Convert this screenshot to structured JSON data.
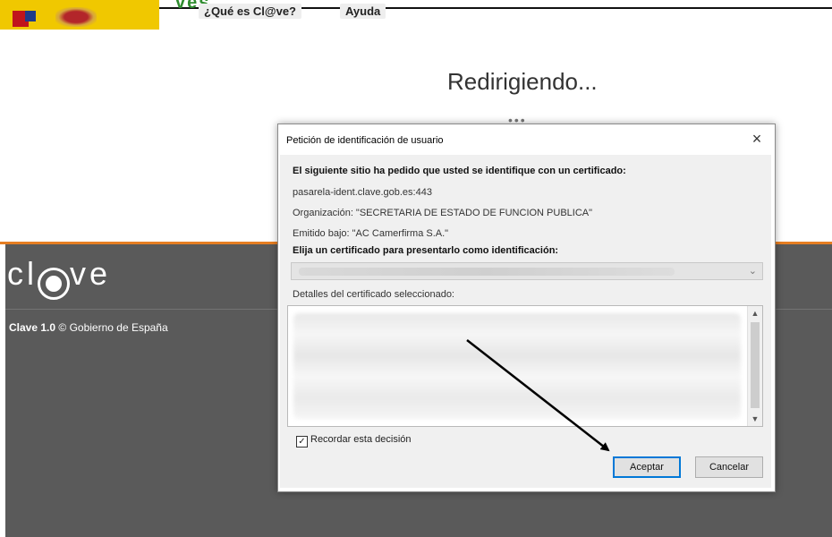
{
  "header": {
    "green_word": "ves",
    "nav": [
      {
        "label": "¿Qué es Cl@ve?"
      },
      {
        "label": "Ayuda"
      }
    ]
  },
  "main": {
    "status_title": "Redirigiendo...",
    "spinner": "•••"
  },
  "footer": {
    "logo_prefix": "cl",
    "logo_suffix": "ve",
    "copyright_bold": "Clave 1.0",
    "copyright_rest": "© Gobierno de España"
  },
  "dialog": {
    "title": "Petición de identificación de usuario",
    "close_symbol": "×",
    "intro": "El siguiente sitio ha pedido que usted se identifique con un certificado:",
    "site": "pasarela-ident.clave.gob.es:443",
    "organization": "Organización: \"SECRETARIA DE ESTADO DE FUNCION PUBLICA\"",
    "issuer": "Emitido bajo: \"AC Camerfirma S.A.\"",
    "choose_label": "Elija un certificado para presentarlo como identificación:",
    "details_label": "Detalles del certificado seleccionado:",
    "remember_label": "Recordar esta decisión",
    "remember_checked": true,
    "check_mark": "✓",
    "accept_label": "Aceptar",
    "cancel_label": "Cancelar",
    "chevron": "⌄",
    "scroll_up": "▲",
    "scroll_down": "▼"
  },
  "colors": {
    "footer_bg": "#5a5a5a",
    "accent_orange": "#e67e22",
    "logo_yellow": "#f0c800",
    "accept_border": "#0078d7"
  }
}
